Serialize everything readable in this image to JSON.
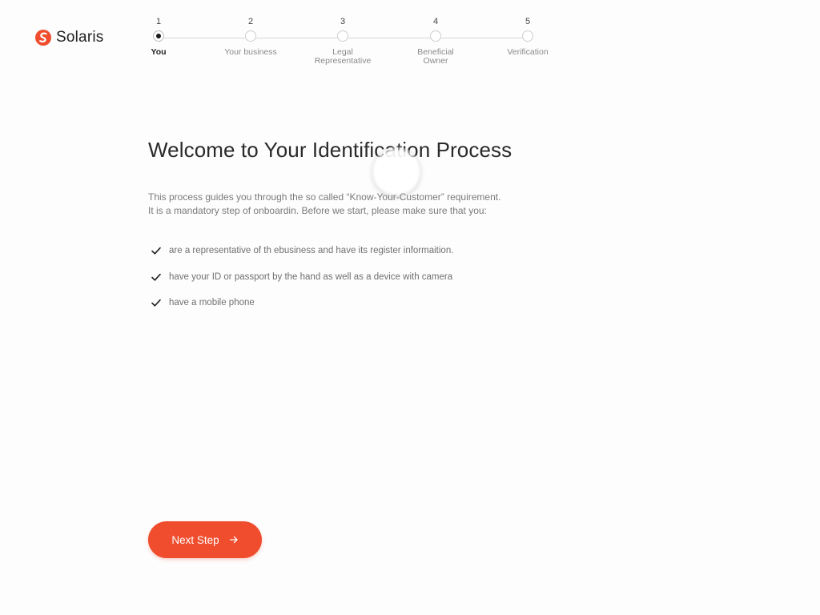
{
  "brand": {
    "name": "Solaris",
    "accent_color": "#ef4d2d",
    "logo_icon": "solaris-logo-icon"
  },
  "stepper": {
    "current_step": 1,
    "steps": [
      {
        "number": "1",
        "label": "You"
      },
      {
        "number": "2",
        "label": "Your business"
      },
      {
        "number": "3",
        "label": "Legal Representative"
      },
      {
        "number": "4",
        "label": "Beneficial Owner"
      },
      {
        "number": "5",
        "label": "Verification"
      }
    ]
  },
  "main": {
    "title": "Welcome to Your Identification Process",
    "intro_line1": "This process guides you through the so called “Know-Your-Customer” requirement.",
    "intro_line2": "It is a mandatory step of onboardin. Before we start, please make sure that you:",
    "checklist": [
      "are a representative of th ebusiness and have its register informaition.",
      "have your ID or passport by the hand as well as a device with camera",
      "have a mobile phone"
    ],
    "check_icon": "checkmark-icon"
  },
  "actions": {
    "next_label": "Next Step",
    "next_icon": "arrow-right-icon"
  }
}
